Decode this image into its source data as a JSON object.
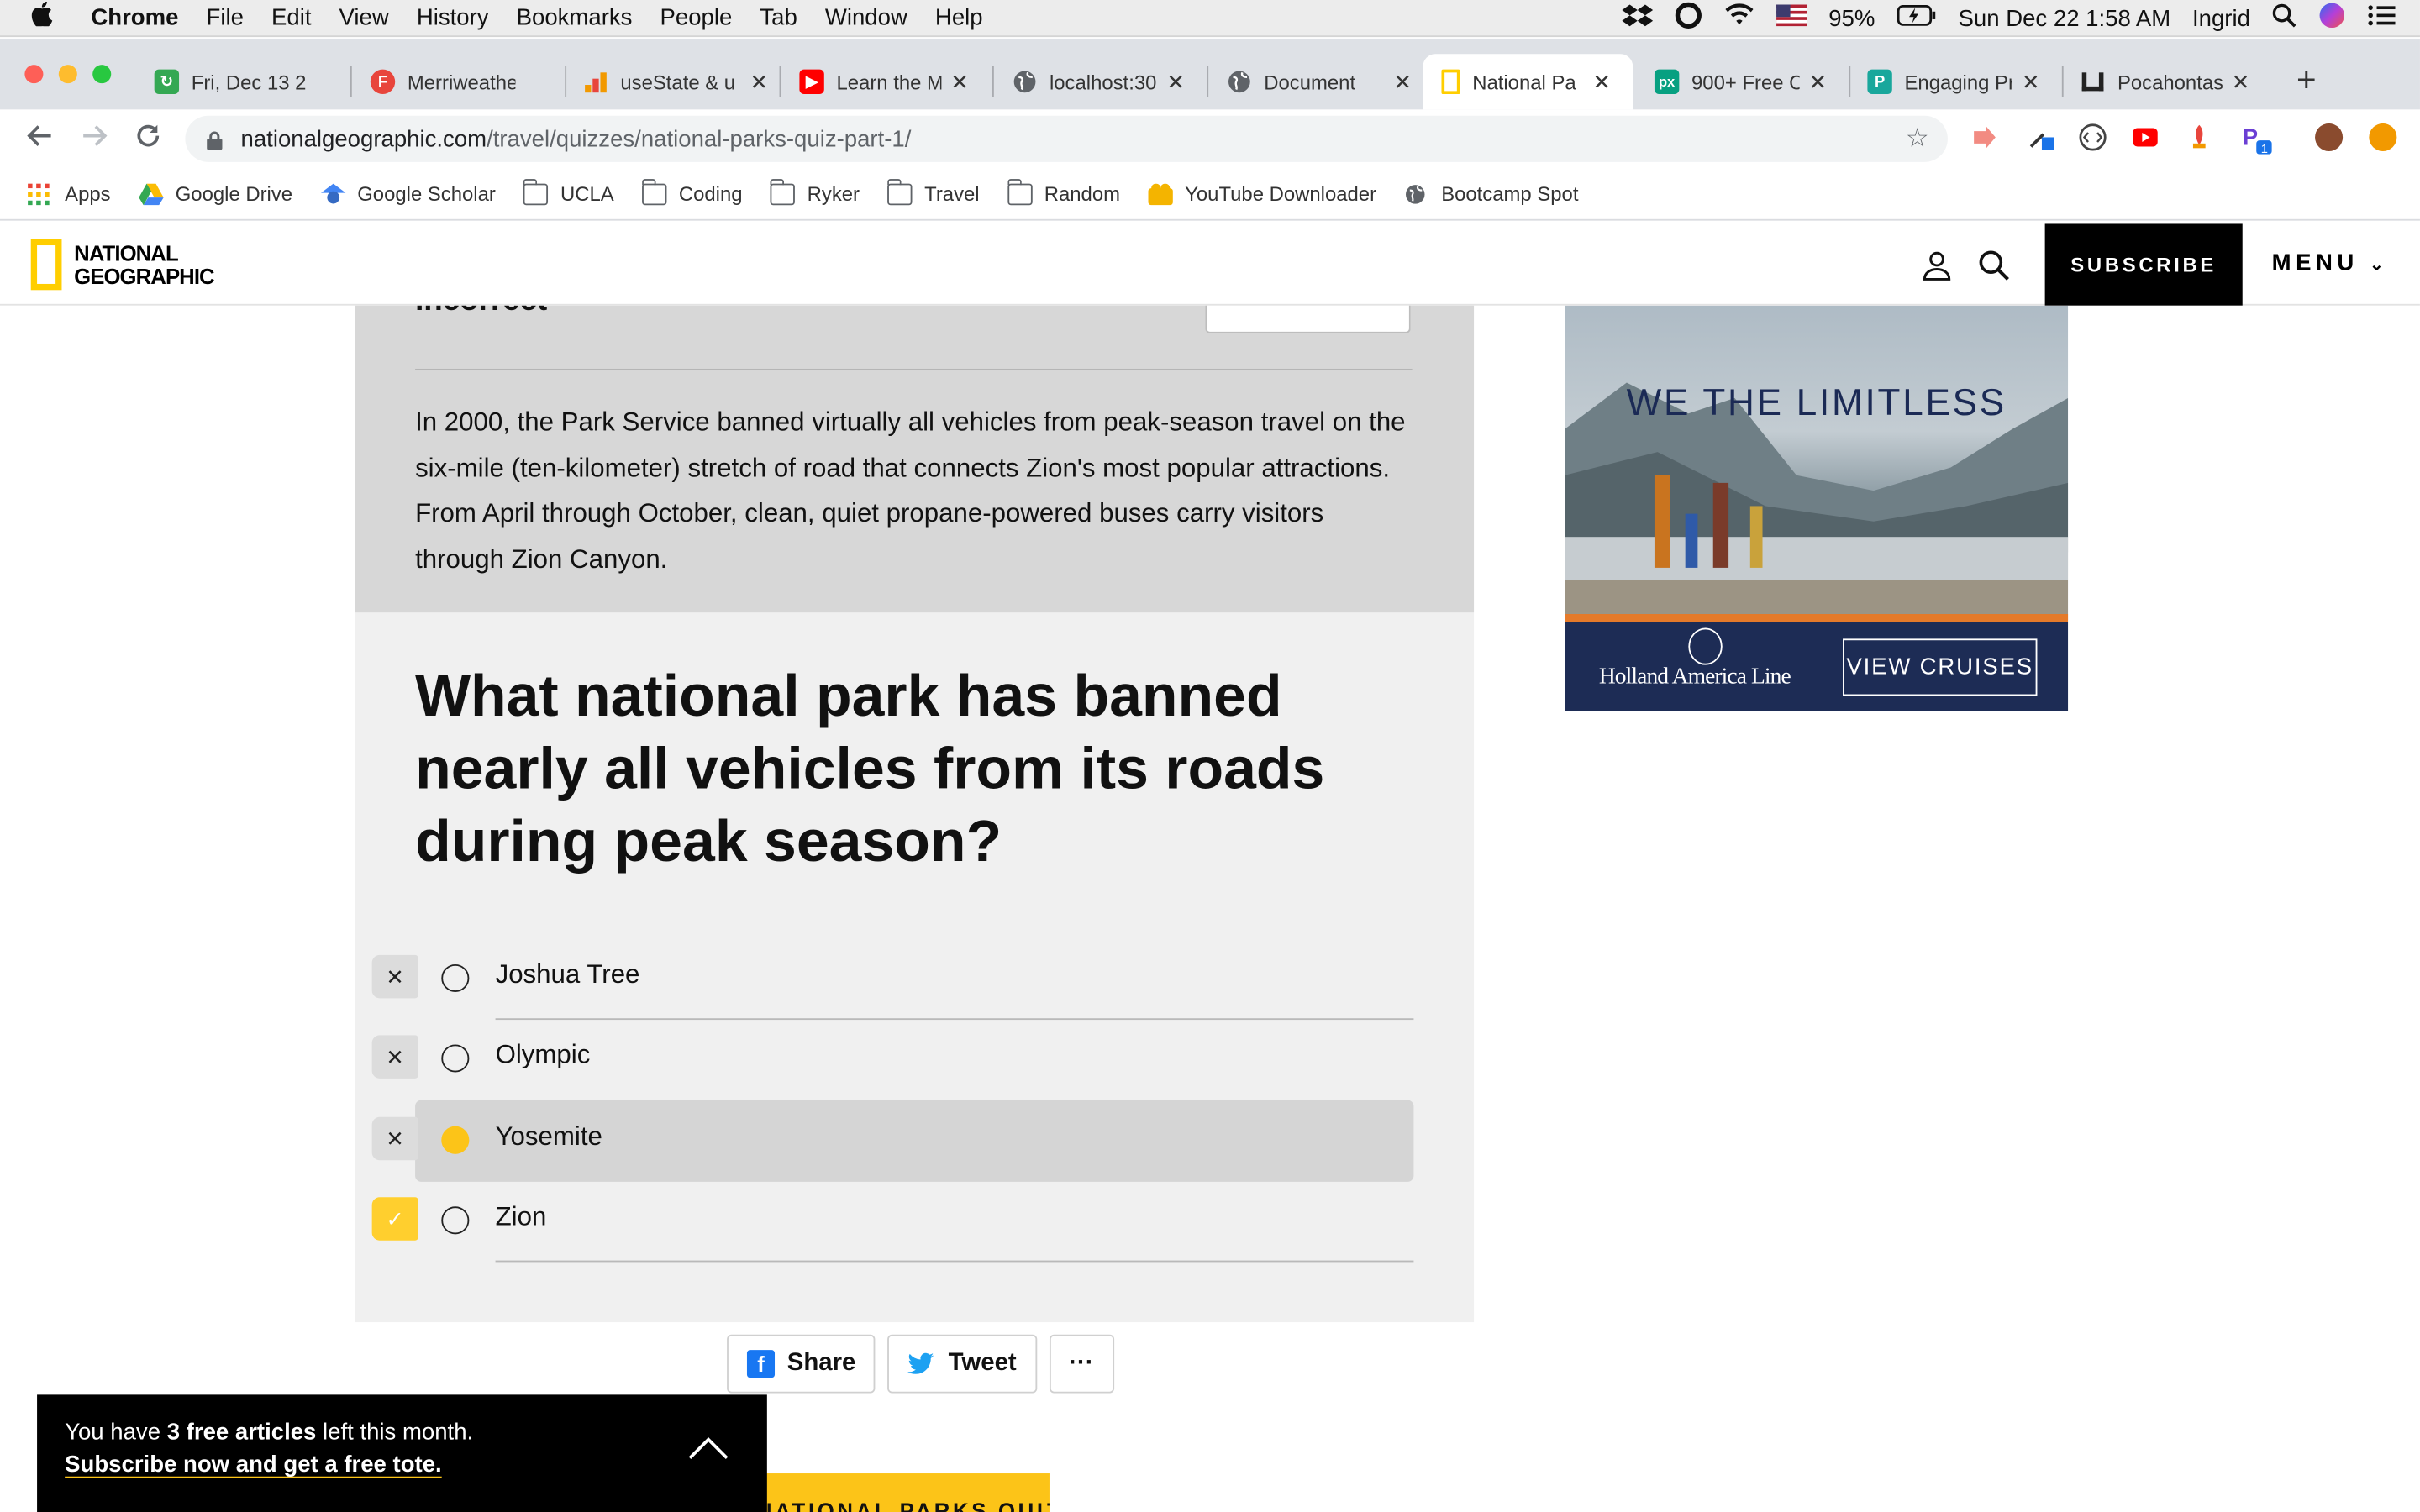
{
  "os_menubar": {
    "app": "Chrome",
    "menus": [
      "File",
      "Edit",
      "View",
      "History",
      "Bookmarks",
      "People",
      "Tab",
      "Window",
      "Help"
    ],
    "battery": "95%",
    "datetime": "Sun Dec 22  1:58 AM",
    "user": "Ingrid"
  },
  "tabs": [
    {
      "label": "Fri, Dec 13 2",
      "icon": "green-sync-icon",
      "color": "#34a853"
    },
    {
      "label": "Merriweathe",
      "icon": "f-icon",
      "color": "#e8453c"
    },
    {
      "label": "useState & u",
      "icon": "chart-icon",
      "color": "#f29900"
    },
    {
      "label": "Learn the M",
      "icon": "youtube-icon",
      "color": "#ff0000"
    },
    {
      "label": "localhost:30",
      "icon": "globe-icon",
      "color": "#5f6368"
    },
    {
      "label": "Document",
      "icon": "globe-icon",
      "color": "#5f6368"
    },
    {
      "label": "National Pa",
      "icon": "natgeo-icon",
      "color": "#ffce00",
      "active": true
    },
    {
      "label": "900+ Free C",
      "icon": "pexels-icon",
      "color": "#07a081"
    },
    {
      "label": "Engaging Pr",
      "icon": "doc-icon",
      "color": "#19a79c"
    },
    {
      "label": "Pocahontas",
      "icon": "bank-icon",
      "color": "#333333"
    }
  ],
  "address_bar": {
    "host": "nationalgeographic.com",
    "path": "/travel/quizzes/national-parks-quiz-part-1/"
  },
  "bookmarks": [
    {
      "label": "Apps",
      "icon": "apps-grid-icon"
    },
    {
      "label": "Google Drive",
      "icon": "drive-icon"
    },
    {
      "label": "Google Scholar",
      "icon": "scholar-icon"
    },
    {
      "label": "UCLA",
      "icon": "folder-icon"
    },
    {
      "label": "Coding",
      "icon": "folder-icon"
    },
    {
      "label": "Ryker",
      "icon": "folder-icon"
    },
    {
      "label": "Travel",
      "icon": "folder-icon"
    },
    {
      "label": "Random",
      "icon": "folder-icon"
    },
    {
      "label": "YouTube Downloader",
      "icon": "downloader-icon"
    },
    {
      "label": "Bootcamp Spot",
      "icon": "globe-icon"
    }
  ],
  "site_header": {
    "logo_line1": "NATIONAL",
    "logo_line2": "GEOGRAPHIC",
    "subscribe": "SUBSCRIBE",
    "menu": "MENU"
  },
  "quiz": {
    "result_heading": "Incorrect",
    "explanation": "In 2000, the Park Service banned virtually all vehicles from peak-season travel on the six-mile (ten-kilometer) stretch of road that connects Zion's most popular attractions. From April through October, clean, quiet propane-powered buses carry visitors through Zion Canyon.",
    "question": "What national park has banned nearly all vehicles from its roads during peak season?",
    "options": [
      {
        "label": "Joshua Tree",
        "mark": "✕",
        "state": "wrong"
      },
      {
        "label": "Olympic",
        "mark": "✕",
        "state": "wrong"
      },
      {
        "label": "Yosemite",
        "mark": "✕",
        "state": "selected-wrong"
      },
      {
        "label": "Zion",
        "mark": "✓",
        "state": "correct"
      }
    ],
    "share_label": "Share",
    "tweet_label": "Tweet",
    "more_label": "···",
    "next_button_label": "NATIONAL PARKS QUIZ"
  },
  "paywall": {
    "prefix": "You have ",
    "count_text": "3 free articles",
    "suffix": " left this month.",
    "cta": "Subscribe now and get a free tote."
  },
  "ad": {
    "headline": "WE THE LIMITLESS",
    "brand": "Holland America Line",
    "cta": "VIEW CRUISES"
  },
  "colors": {
    "natgeo_yellow": "#ffce00",
    "selected_radio": "#fcc418",
    "ad_navy": "#1d2c55"
  }
}
